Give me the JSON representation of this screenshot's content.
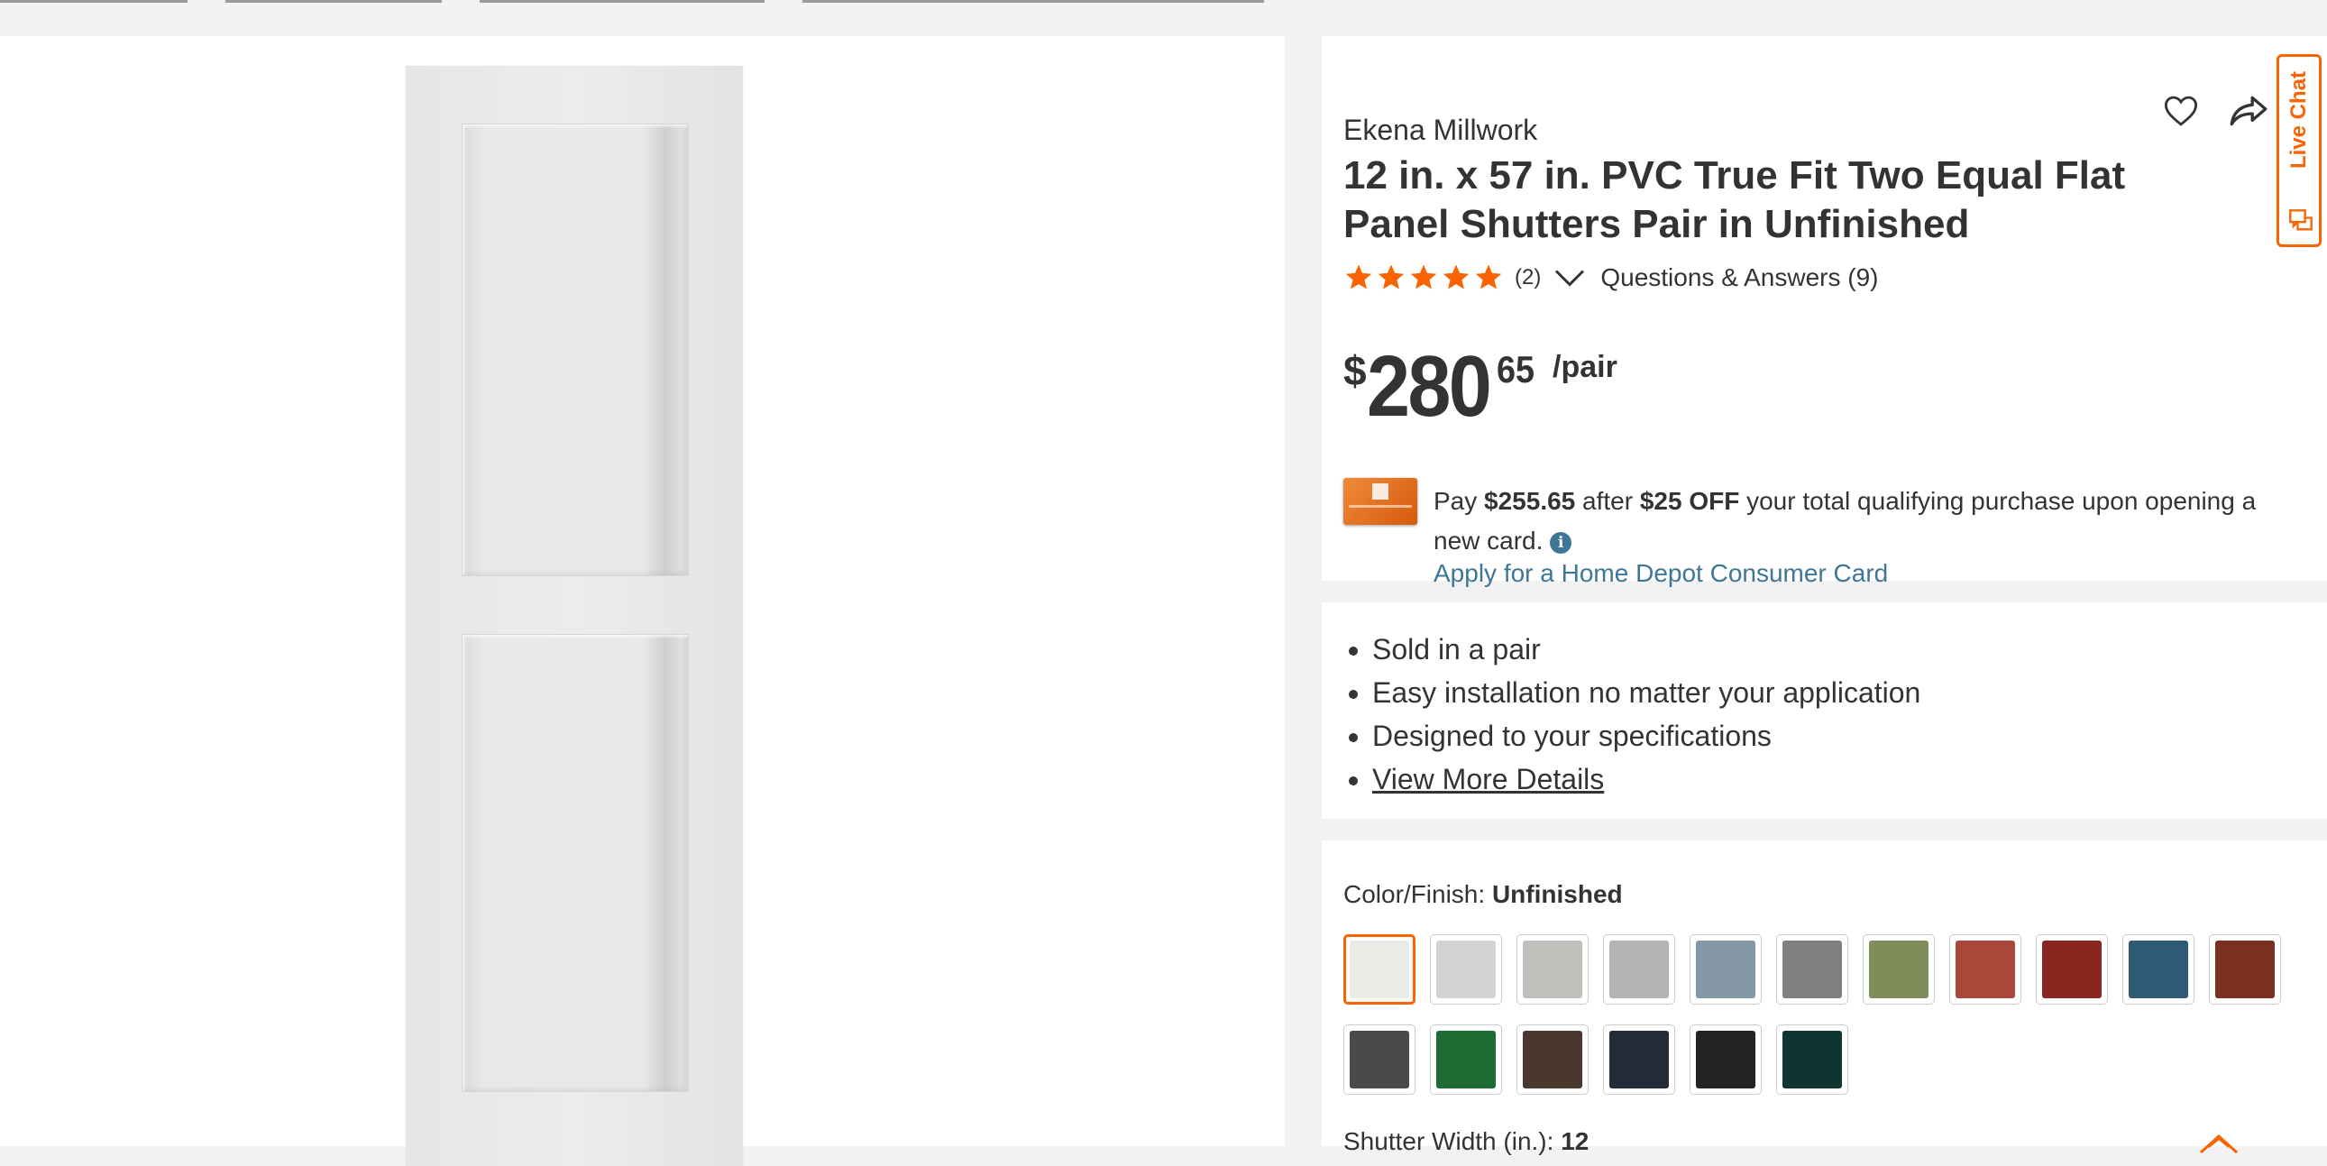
{
  "product": {
    "brand": "Ekena Millwork",
    "title": "12 in. x 57 in. PVC True Fit Two Equal Flat Panel Shutters Pair in Unfinished",
    "rating_count": "(2)",
    "rating_stars": 5,
    "qa_link": "Questions & Answers (9)"
  },
  "price": {
    "currency": "$",
    "dollars": "280",
    "cents": "65",
    "unit": "/pair"
  },
  "offer": {
    "text_pay": "Pay",
    "amount": "$255.65",
    "text_after": "after",
    "discount": "$25 OFF",
    "text_rest": "your total qualifying purchase upon opening a new card.",
    "apply_link": "Apply for a Home Depot Consumer Card"
  },
  "highlights": [
    "Sold in a pair",
    "Easy installation no matter your application",
    "Designed to your specifications"
  ],
  "view_more": "View More Details",
  "color": {
    "label": "Color/Finish:",
    "selected": "Unfinished",
    "swatches": [
      "#e9ebe7",
      "#d3d3d3",
      "#bfc0bb",
      "#b3b3b3",
      "#8499a5",
      "#7f8181",
      "#7f8d5a",
      "#a9473b",
      "#8b2520",
      "#2f5a75",
      "#7b2f1f",
      "#4a4a4a",
      "#1f6b34",
      "#4a382e",
      "#232a38",
      "#232323",
      "#0f3530"
    ],
    "selected_index": 0
  },
  "width": {
    "label": "Shutter Width (in.):",
    "value": "12"
  },
  "livechat": "Live Chat",
  "colors": {
    "accent": "#f96302",
    "link": "#3e7697",
    "text": "#333333"
  }
}
